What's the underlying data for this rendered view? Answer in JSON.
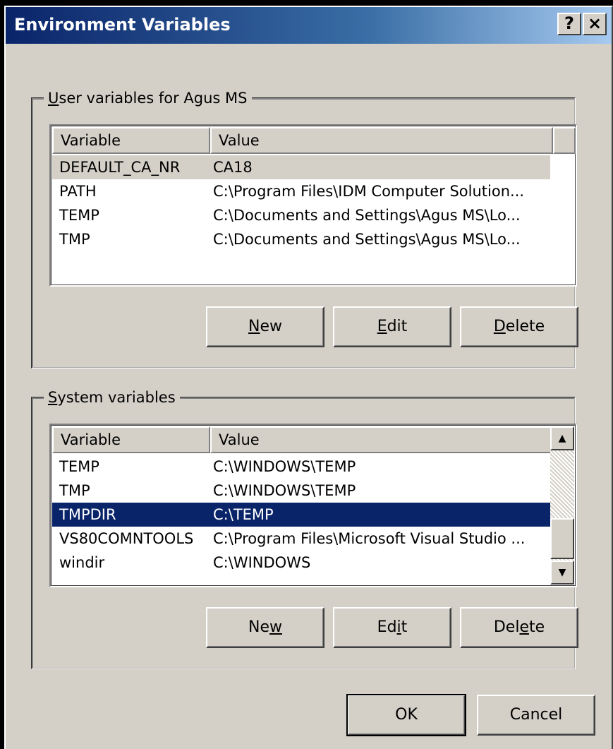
{
  "window": {
    "title": "Environment Variables",
    "help_button": "?",
    "close_button": "×"
  },
  "user_vars": {
    "group_label_underlined": "U",
    "group_label_rest": "ser variables for Agus MS",
    "columns": [
      "Variable",
      "Value"
    ],
    "rows": [
      {
        "variable": "DEFAULT_CA_NR",
        "value": "CA18"
      },
      {
        "variable": "PATH",
        "value": "C:\\Program Files\\IDM Computer Solution..."
      },
      {
        "variable": "TEMP",
        "value": "C:\\Documents and Settings\\Agus MS\\Lo..."
      },
      {
        "variable": "TMP",
        "value": "C:\\Documents and Settings\\Agus MS\\Lo..."
      }
    ],
    "selected_row": 0,
    "buttons": {
      "new": {
        "u": "N",
        "rest": "ew"
      },
      "edit": {
        "u": "E",
        "rest": "dit"
      },
      "delete": {
        "u": "D",
        "rest": "elete"
      }
    }
  },
  "system_vars": {
    "group_label_underlined": "S",
    "group_label_rest": "ystem variables",
    "columns": [
      "Variable",
      "Value"
    ],
    "rows": [
      {
        "variable": "TEMP",
        "value": "C:\\WINDOWS\\TEMP"
      },
      {
        "variable": "TMP",
        "value": "C:\\WINDOWS\\TEMP"
      },
      {
        "variable": "TMPDIR",
        "value": "C:\\TEMP"
      },
      {
        "variable": "VS80COMNTOOLS",
        "value": "C:\\Program Files\\Microsoft Visual Studio ..."
      },
      {
        "variable": "windir",
        "value": "C:\\WINDOWS"
      }
    ],
    "selected_row": 2,
    "scroll_up": "▲",
    "scroll_down": "▼",
    "buttons": {
      "new": {
        "pre": "Ne",
        "u": "w",
        "post": ""
      },
      "edit": {
        "pre": "Ed",
        "u": "i",
        "post": "t"
      },
      "delete": {
        "pre": "Del",
        "u": "e",
        "post": "te"
      }
    }
  },
  "dialog_buttons": {
    "ok": "OK",
    "cancel": "Cancel"
  }
}
